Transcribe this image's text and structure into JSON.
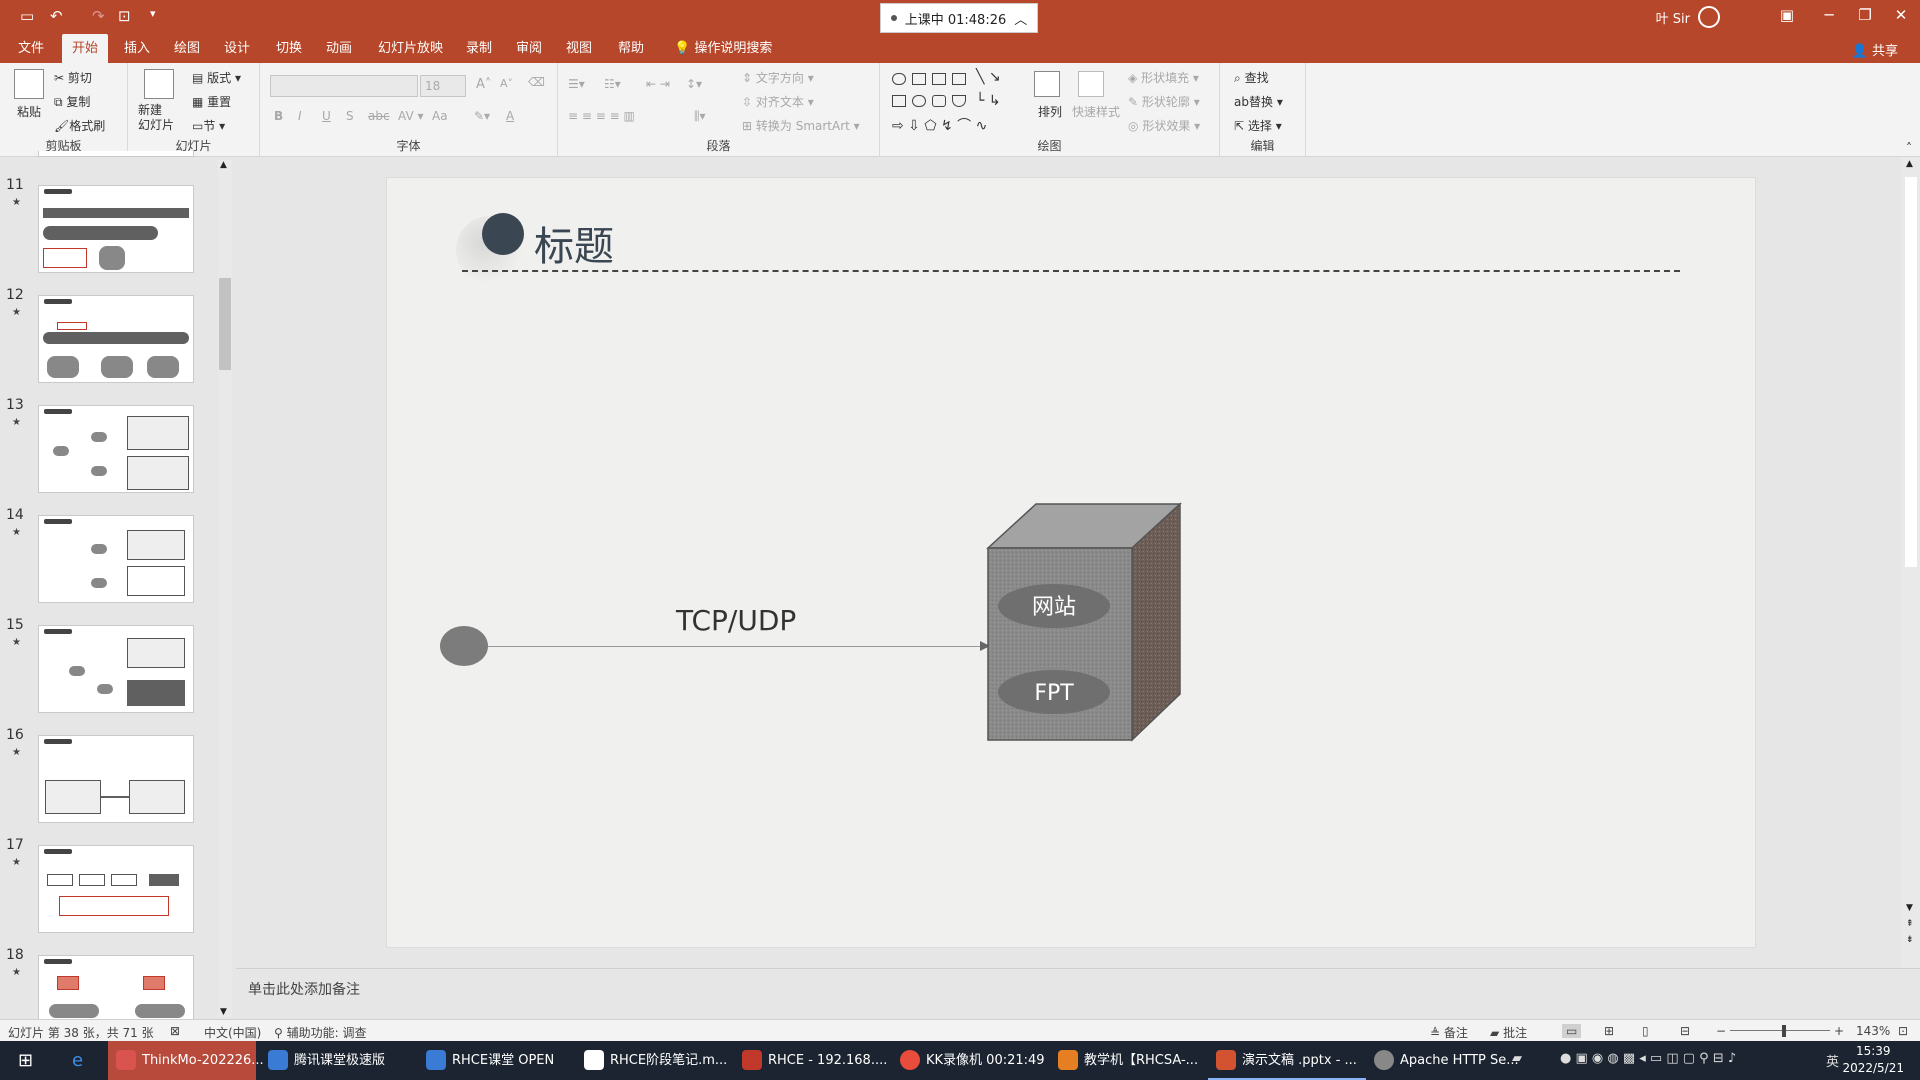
{
  "titlebar": {
    "recording": "上课中 01:48:26",
    "user": "叶 Sir",
    "colors": {
      "accent": "#b7472a"
    }
  },
  "tabs": [
    "文件",
    "开始",
    "插入",
    "绘图",
    "设计",
    "切换",
    "动画",
    "幻灯片放映",
    "录制",
    "审阅",
    "视图",
    "帮助"
  ],
  "active_tab": "开始",
  "tell_me": "操作说明搜索",
  "share": "共享",
  "ribbon": {
    "clipboard": {
      "paste": "粘贴",
      "cut": "剪切",
      "copy": "复制",
      "format_painter": "格式刷",
      "label": "剪贴板"
    },
    "slides": {
      "new_slide": "新建\n幻灯片",
      "layout": "版式",
      "reset": "重置",
      "section": "节",
      "label": "幻灯片"
    },
    "font": {
      "label": "字体",
      "size": "18",
      "bold": "B",
      "italic": "I",
      "underline": "U",
      "strike": "S",
      "case": "Aa",
      "color": "A"
    },
    "paragraph": {
      "label": "段落",
      "text_direction": "文字方向",
      "align_text": "对齐文本",
      "smartart": "转换为 SmartArt"
    },
    "drawing": {
      "label": "绘图",
      "arrange": "排列",
      "quick_styles": "快速样式",
      "shape_fill": "形状填充",
      "shape_outline": "形状轮廓",
      "shape_effects": "形状效果"
    },
    "editing": {
      "label": "编辑",
      "find": "查找",
      "replace": "替换",
      "select": "选择"
    }
  },
  "thumbnails": [
    {
      "num": "11"
    },
    {
      "num": "12"
    },
    {
      "num": "13"
    },
    {
      "num": "14"
    },
    {
      "num": "15"
    },
    {
      "num": "16"
    },
    {
      "num": "17"
    },
    {
      "num": "18"
    }
  ],
  "slide": {
    "title": "标题",
    "connection_label": "TCP/UDP",
    "server_services": [
      "网站",
      "FPT"
    ]
  },
  "notes_placeholder": "单击此处添加备注",
  "status": {
    "slide_info": "幻灯片 第 38 张，共 71 张",
    "language": "中文(中国)",
    "accessibility": "辅助功能: 调查",
    "notes": "备注",
    "comments": "批注",
    "zoom": "143%"
  },
  "taskbar": {
    "items": [
      {
        "label": "ThinkMo-202226...",
        "color": "#d9534f"
      },
      {
        "label": "腾讯课堂极速版",
        "color": "#3a7bd5"
      },
      {
        "label": "RHCE课堂 OPEN",
        "color": "#3a7bd5"
      },
      {
        "label": "RHCE阶段笔记.m...",
        "color": "#ffffff"
      },
      {
        "label": "RHCE - 192.168....",
        "color": "#c0392b"
      },
      {
        "label": "KK录像机 00:21:49",
        "color": "#e74c3c"
      },
      {
        "label": "教学机【RHCSA-...",
        "color": "#e67e22"
      },
      {
        "label": "演示文稿 .pptx - ...",
        "color": "#d35230"
      },
      {
        "label": "Apache HTTP Se...",
        "color": "#888888"
      }
    ],
    "ime": "英",
    "time": "15:39",
    "date": "2022/5/21"
  }
}
